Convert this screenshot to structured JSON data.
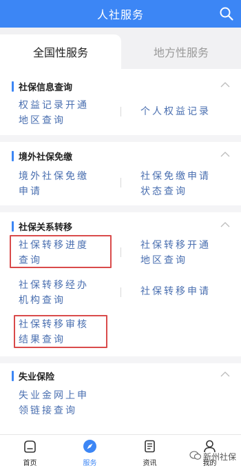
{
  "header": {
    "title": "人社服务"
  },
  "tabs": [
    {
      "label": "全国性服务",
      "active": true
    },
    {
      "label": "地方性服务",
      "active": false
    }
  ],
  "sections": [
    {
      "title": "社保信息查询",
      "items": [
        [
          "权益记录开通",
          "地区查询"
        ],
        [
          "个人权益记录"
        ]
      ]
    },
    {
      "title": "境外社保免缴",
      "items": [
        [
          "境外社保免缴",
          "申请"
        ],
        [
          "社保免缴申请",
          "状态查询"
        ]
      ]
    },
    {
      "title": "社保关系转移",
      "items": [
        [
          "社保转移进度",
          "查询"
        ],
        [
          "社保转移开通",
          "地区查询"
        ],
        [
          "社保转移经办",
          "机构查询"
        ],
        [
          "社保转移申请"
        ],
        [
          "社保转移审核",
          "结果查询"
        ]
      ]
    },
    {
      "title": "失业保险",
      "items": [
        [
          "失业金网上申",
          "领链接查询"
        ]
      ]
    }
  ],
  "footer": [
    {
      "label": "首页",
      "icon": "home-icon"
    },
    {
      "label": "服务",
      "icon": "compass-icon",
      "active": true
    },
    {
      "label": "资讯",
      "icon": "news-icon"
    },
    {
      "label": "我的",
      "icon": "user-icon"
    }
  ],
  "watermark": "新州社保",
  "colors": {
    "accent": "#3c86f5",
    "link": "#4a6fb0",
    "highlight": "#d94a4a"
  }
}
